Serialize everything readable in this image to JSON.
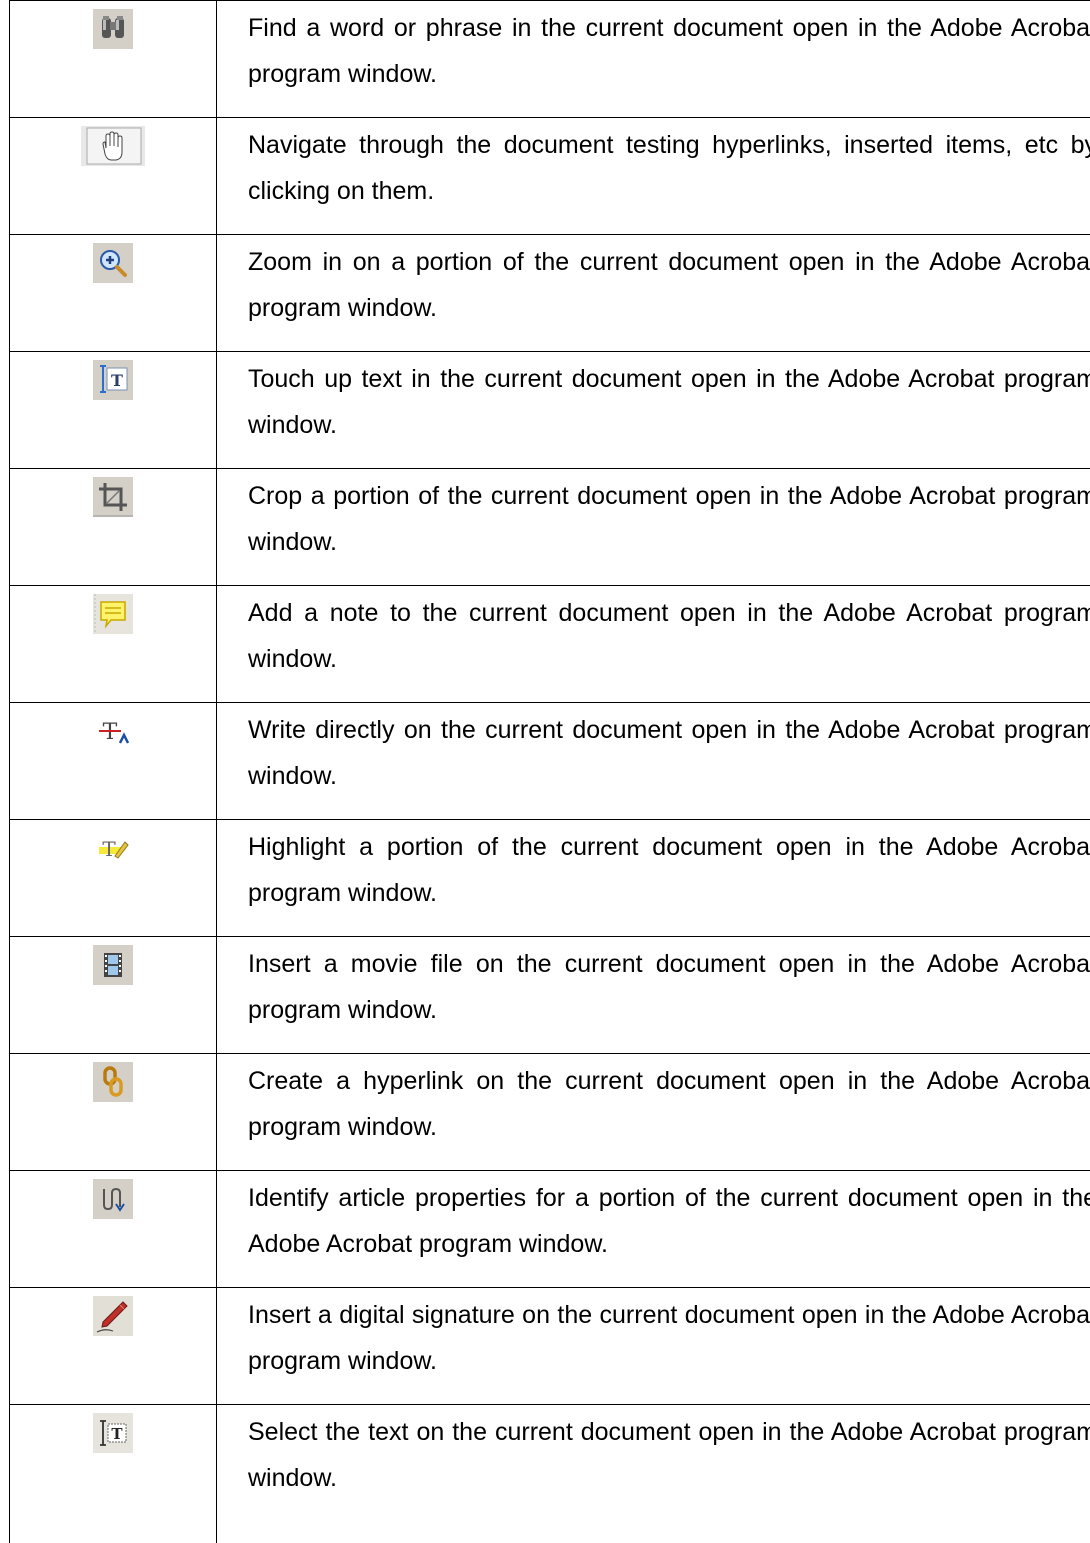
{
  "rows": [
    {
      "icon": "binoculars-icon",
      "text": "Find a word or phrase in the current document open in the Adobe Acrobat program window."
    },
    {
      "icon": "hand-tool-icon",
      "text": "Navigate through the document testing hyperlinks, inserted items, etc by clicking on them."
    },
    {
      "icon": "zoom-in-icon",
      "text": "Zoom in on a portion of the current document open in the Adobe Acrobat program window."
    },
    {
      "icon": "touchup-text-icon",
      "text": "Touch up text in the current document open in the Adobe Acrobat program window."
    },
    {
      "icon": "crop-icon",
      "text": "Crop a portion of the current document open in the Adobe Acrobat program window."
    },
    {
      "icon": "note-icon",
      "text": "Add a note to the current document open in the Adobe Acrobat program window."
    },
    {
      "icon": "pencil-text-icon",
      "text": "Write directly on the current document open in the Adobe Acrobat program window."
    },
    {
      "icon": "highlight-text-icon",
      "text": "Highlight a portion of the current document open in the Adobe Acrobat program window."
    },
    {
      "icon": "movie-icon",
      "text": "Insert a movie file on the current document open in the Adobe Acrobat program window."
    },
    {
      "icon": "link-icon",
      "text": "Create a hyperlink on the current document open in the Adobe Acrobat program window."
    },
    {
      "icon": "article-icon",
      "text": "Identify article properties for a portion of the current document open in the Adobe Acrobat program window."
    },
    {
      "icon": "signature-pen-icon",
      "text": "Insert a digital signature on the current document open in the Adobe Acrobat program window."
    },
    {
      "icon": "select-text-icon",
      "text": "Select the text on the current document open in the Adobe Acrobat program window."
    }
  ],
  "colors": {
    "icon_bg": "#d4d0c8",
    "border": "#000000",
    "text": "#000000"
  }
}
